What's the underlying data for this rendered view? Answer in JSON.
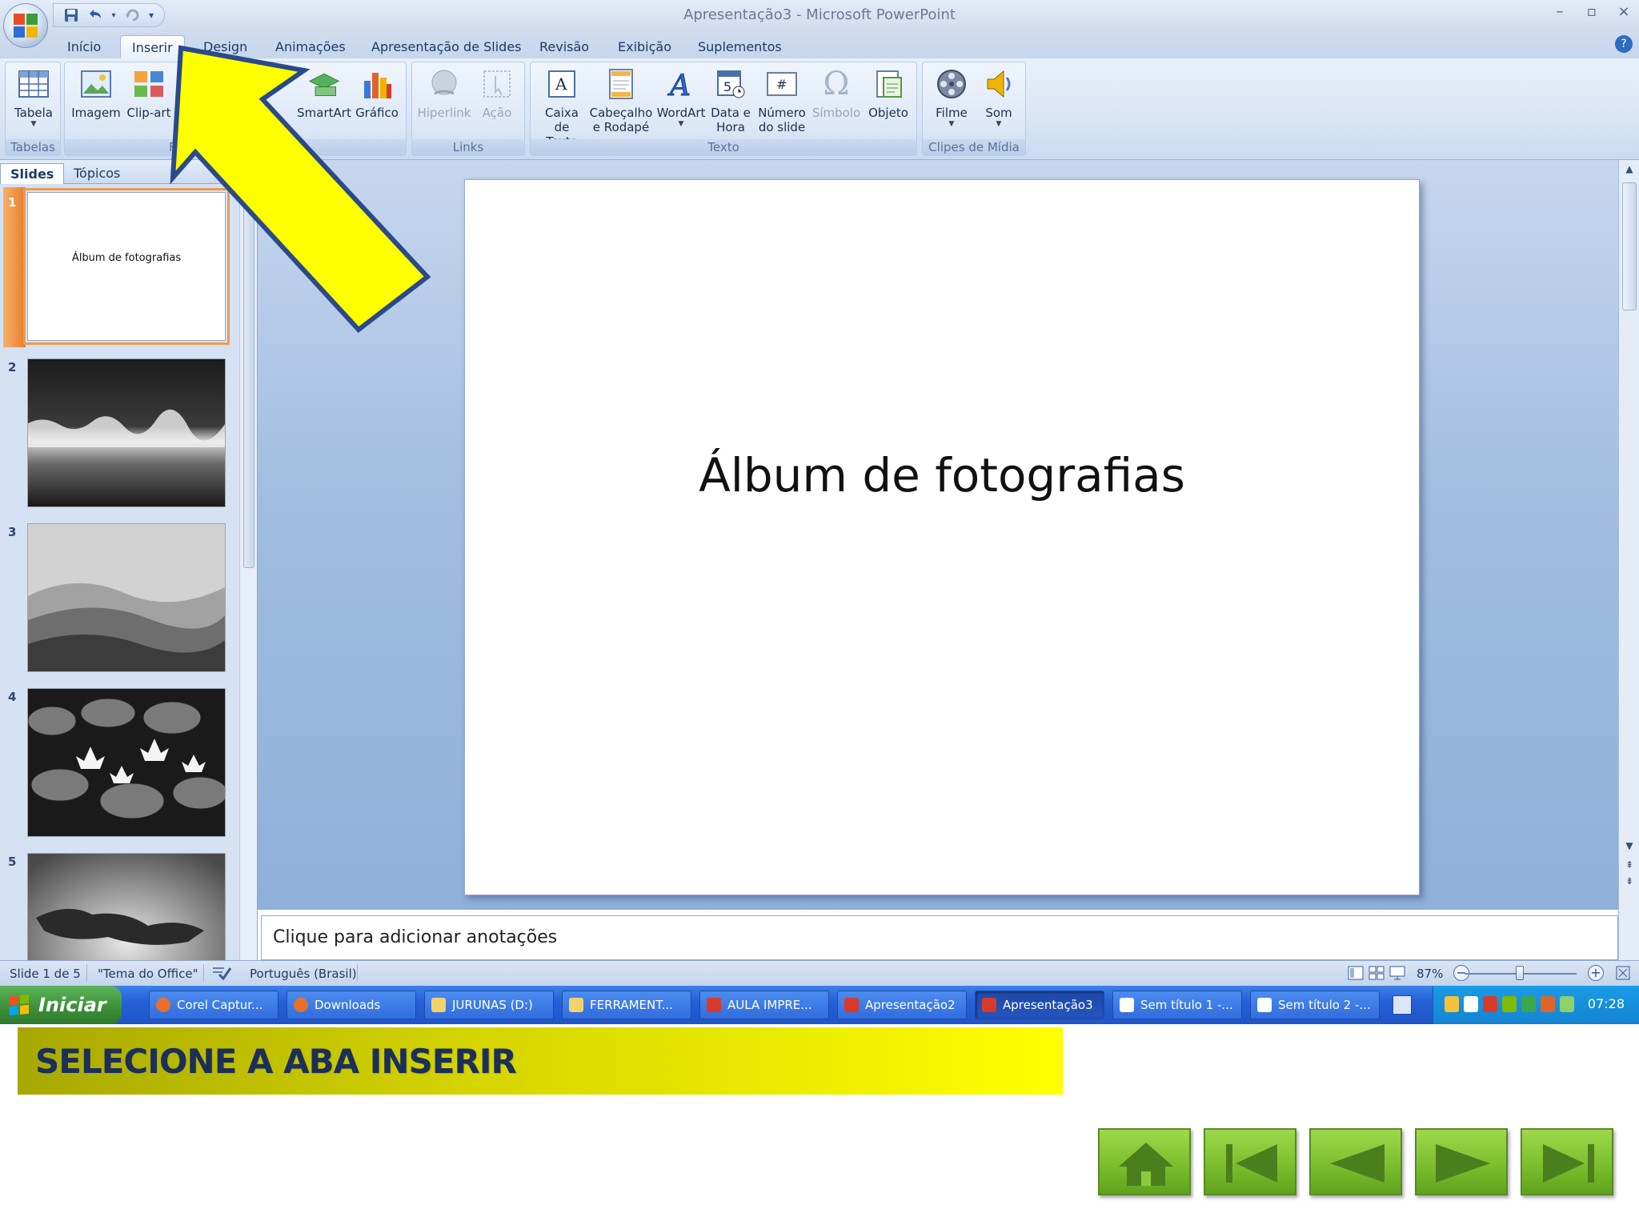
{
  "window": {
    "title": "Apresentação3 - Microsoft PowerPoint",
    "controls": {
      "minimize": "–",
      "restore": "▫",
      "close": "×"
    }
  },
  "quick_access": {
    "save": "save-icon",
    "undo": "undo-icon",
    "redo": "redo-icon",
    "customize": "▾"
  },
  "tabs": [
    {
      "label": "Início"
    },
    {
      "label": "Inserir",
      "active": true
    },
    {
      "label": "Design"
    },
    {
      "label": "Animações"
    },
    {
      "label": "Apresentação de Slides"
    },
    {
      "label": "Revisão"
    },
    {
      "label": "Exibição"
    },
    {
      "label": "Suplementos"
    }
  ],
  "help": "?",
  "ribbon": {
    "groups": {
      "tabelas": {
        "label": "Tabelas",
        "buttons": [
          {
            "label": "Tabela"
          }
        ]
      },
      "ilustracoes": {
        "label_partial": "F",
        "buttons": [
          {
            "label": "Imagem"
          },
          {
            "label": "Clip-art"
          },
          {
            "label": "SmartArt"
          },
          {
            "label": "Gráfico"
          }
        ]
      },
      "links": {
        "label": "Links",
        "buttons": [
          {
            "label": "Hiperlink"
          },
          {
            "label": "Ação"
          }
        ]
      },
      "texto": {
        "label": "Texto",
        "buttons": [
          {
            "label1": "Caixa",
            "label2": "de Texto"
          },
          {
            "label1": "Cabeçalho",
            "label2": "e Rodapé"
          },
          {
            "label1": "WordArt"
          },
          {
            "label1": "Data e",
            "label2": "Hora"
          },
          {
            "label1": "Número",
            "label2": "do slide"
          },
          {
            "label1": "Símbolo"
          },
          {
            "label1": "Objeto"
          }
        ]
      },
      "clipes": {
        "label": "Clipes de Mídia",
        "buttons": [
          {
            "label": "Filme"
          },
          {
            "label": "Som"
          }
        ]
      }
    }
  },
  "left_pane": {
    "tabs": [
      {
        "label": "Slides",
        "active": true
      },
      {
        "label": "Tópicos"
      }
    ],
    "close": "×",
    "thumbnails": [
      {
        "number": "1",
        "caption": "Álbum de fotografias",
        "selected": true
      },
      {
        "number": "2",
        "caption": ""
      },
      {
        "number": "3",
        "caption": ""
      },
      {
        "number": "4",
        "caption": ""
      },
      {
        "number": "5",
        "caption": ""
      }
    ]
  },
  "slide": {
    "title": "Álbum de fotografias"
  },
  "notes": {
    "placeholder": "Clique para adicionar anotações"
  },
  "status": {
    "slide_info": "Slide 1 de 5",
    "theme": "\"Tema do Office\"",
    "language": "Português (Brasil)",
    "zoom": "87%",
    "zoom_out": "−",
    "zoom_in": "+"
  },
  "taskbar": {
    "start": "Iniciar",
    "tasks": [
      {
        "label": "Corel Captur...",
        "color": "#e8702a"
      },
      {
        "label": "Downloads",
        "color": "#e8702a"
      },
      {
        "label": "JURUNAS (D:)",
        "color": "#f2d36b"
      },
      {
        "label": "FERRAMENT...",
        "color": "#f2d36b"
      },
      {
        "label": "AULA IMPRE...",
        "color": "#d83a2a"
      },
      {
        "label": "Apresentação2",
        "color": "#d83a2a"
      },
      {
        "label": "Apresentação3",
        "color": "#d83a2a",
        "active": true
      },
      {
        "label": "Sem título 1 -...",
        "color": "#ffffff"
      },
      {
        "label": "Sem título 2 -...",
        "color": "#ffffff"
      }
    ],
    "clock": "07:28"
  },
  "tutorial": {
    "banner": "SELECIONE A ABA INSERIR",
    "nav": [
      "home",
      "first",
      "previous",
      "next",
      "last"
    ]
  },
  "colors": {
    "arrow_fill": "#ffff00",
    "arrow_stroke": "#2a4a8a",
    "nav_green": "#7cbf2e",
    "selection_orange": "#f09a4f"
  }
}
